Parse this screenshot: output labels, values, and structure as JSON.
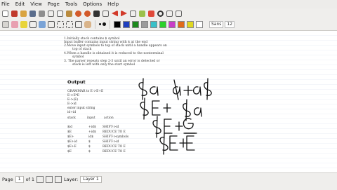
{
  "menu": [
    "File",
    "Edit",
    "View",
    "Page",
    "Tools",
    "Options",
    "Help"
  ],
  "toolbar": {
    "font_label": "Sans",
    "font_size": "12",
    "colors": [
      "#000000",
      "#1f3fbf",
      "#1c8a1c",
      "#9b9b9b",
      "#39c0c8",
      "#2ad12a",
      "#c83cc8",
      "#e06a1a",
      "#e0d820",
      "#ffffff"
    ]
  },
  "document": {
    "body_lines": [
      "1.Initially stack contains $ symbol",
      "Input buffer contains input string with $ at the end",
      "2.Move input symbols to top of stack until a handle appears on",
      "top of stack",
      "4.When a handle is obtained it is reduced to the nonterminal",
      "symbol",
      "3. The parser repeats step 2-3 until an error is detected or",
      "stack is left with only the start symbol"
    ],
    "output_heading": "Output",
    "grammar_lines": [
      "GRAMMAR to E->E+E",
      "E->E*E",
      "E->(E)",
      "E->id",
      "enter input string",
      "id+id"
    ],
    "table_header": [
      "stack",
      "input",
      "action"
    ],
    "table_rows": [
      [
        "$id",
        "+id$",
        "SHIFT->id"
      ],
      [
        "$E",
        "+id$",
        "REDUCE TO E"
      ],
      [
        "$E+",
        "id$",
        "SHIFT->symbols"
      ],
      [
        "$E+id",
        "$",
        "SHIFT->id"
      ],
      [
        "$E+E",
        "$",
        "REDUCE TO E"
      ],
      [
        "$E",
        "$",
        "REDUCE TO E"
      ]
    ]
  },
  "statusbar": {
    "page_label": "Page",
    "page_value": "1",
    "page_of": "of 1",
    "layer_label": "Layer:",
    "layer_value": "Layer 1"
  }
}
